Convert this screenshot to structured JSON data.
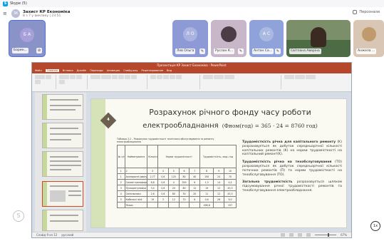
{
  "window": {
    "title": "Skype (5)"
  },
  "conversation": {
    "title": "Захист КР Економіка",
    "subtitle": "8 з 7 у виклику | 23:51",
    "initials": "ЗК"
  },
  "header": {
    "participants_label": "Персонали"
  },
  "participants": {
    "self": {
      "initials": "Б А",
      "name": "Борин..."
    },
    "tiles": [
      {
        "initials": "Л О",
        "name": "Лев Ольга",
        "color": "#8e9ad6",
        "photo": false
      },
      {
        "initials": "",
        "name": "Руслан К...",
        "color": "#c7b7c9",
        "photo": true
      },
      {
        "initials": "А С",
        "name": "Антон Са...",
        "color": "#8fa2d9",
        "photo": false
      },
      {
        "initials": "",
        "name": "Світлана Аверіна",
        "color": "#7a8f6a",
        "photo": true
      },
      {
        "initials": "",
        "name": "Анжела ...",
        "color": "#d9c6b4",
        "photo": true
      }
    ]
  },
  "ppt": {
    "title": "Презентація КР Захист Економіка - PowerPoint",
    "tabs": [
      "Файл",
      "Главная",
      "Вставка",
      "Дизайн",
      "Переходы",
      "Анимация",
      "Слайд-шоу",
      "Рецензирование",
      "Вид"
    ],
    "active_tab": "Главная",
    "status": {
      "slide": "Слайд 9 из 12",
      "lang": "русский",
      "zoom": "67%"
    }
  },
  "slide": {
    "number": "4",
    "title_line1": "Розрахунок річного фонду часу роботи",
    "title_line2": "електрообладнання",
    "formula": "(Фном(год) = 365 · 24 = 8760 год)",
    "table_caption": "Таблиця 2.2 – Розрахунок трудомісткості технічного обслуговування та ремонту електрообладнання",
    "table_headers": [
      "№ п/п",
      "Найменування",
      "Кількість",
      "Норма трудомісткості",
      "",
      "",
      "",
      "Трудомісткість, люд.-год",
      "",
      ""
    ],
    "table_rows": [
      [
        "1",
        "2",
        "3",
        "4",
        "5",
        "6",
        "7",
        "8",
        "9",
        "10"
      ],
      [
        "1",
        "Асинхронні двигуни",
        "2,77",
        "0,6",
        "120",
        "80",
        "40",
        "150",
        "24",
        "70"
      ],
      [
        "2",
        "Силові трансформатори",
        "8,8",
        "0,6",
        "4",
        "300",
        "6",
        "1,3",
        "14",
        "4,4"
      ],
      [
        "3",
        "Пускорегулююча апаратура",
        "3,4",
        "0,6",
        "20",
        "80",
        "12",
        "19",
        "12",
        "45,3"
      ],
      [
        "4",
        "Світильники",
        "2,6",
        "0,6",
        "80",
        "30",
        "20",
        "11",
        "12",
        "45,3"
      ],
      [
        "5",
        "Кабельні лінії",
        "19",
        "3",
        "12",
        "70",
        "6",
        "0,6",
        "26",
        "9,0"
      ],
      [
        "",
        "Разом",
        "",
        "",
        "",
        "",
        "",
        "496,8",
        "",
        "157"
      ]
    ],
    "bullets": [
      {
        "bold": "Трудомісткість річна для капітального ремонту",
        "text": " (K) розраховується як добуток середньорічної кількості капітальних ремонтів (K) на норми трудомісткості на капітальний ремонт(K)."
      },
      {
        "bold": "Трудомісткість річна на техобслуговування",
        "text": " (TO) розраховується як добуток середньорічної кількості поточних ремонтів (П) та норми трудомісткості на техобслуговування (TO)."
      },
      {
        "bold": "Загальна трудомісткість",
        "text": " розраховується шляхом підсумовування річної трудомісткості ремонтів та техобслуговування електрообладнання."
      }
    ]
  },
  "share": {
    "logo_glyph": "S",
    "fit_label": "1x"
  }
}
